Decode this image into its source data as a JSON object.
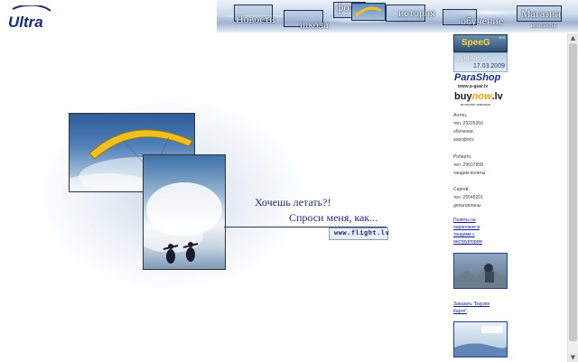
{
  "logo": {
    "text": "Ultra"
  },
  "nav": {
    "news": "Новости",
    "school": "школа",
    "photo": "фото",
    "history": "история",
    "training": "обучение",
    "shop": "Магазин",
    "contacts": "контакты"
  },
  "sidebar": {
    "speedo_label": "SpeeG",
    "speedo_numbers": "104",
    "updated_label": "Updated",
    "updated_date": "17.03.2009",
    "parashop": "ParaShop",
    "parashop_url": "www.a-gear.lv",
    "buynow_1": "buy",
    "buynow_2": "now",
    "buynow_3": ".lv",
    "buynow_sub": "интернет-магазин",
    "contacts": [
      {
        "name": "Антон,",
        "phone": "тел. 29225359",
        "note": "обучение,",
        "note2": "аэрофото"
      },
      {
        "name": "Роберто,",
        "phone": "тел. 29637858",
        "note": "тандем-полеты",
        "note2": ""
      },
      {
        "name": "Сергей,",
        "phone": "тел. 25545201",
        "note": "дельтапланы",
        "note2": ""
      }
    ],
    "link1_lines": [
      "Полеты на",
      "параплане в",
      "тандеме с",
      "инструктором"
    ],
    "link2_lines": [
      "Заказать \"Баузпи",
      "Карте\""
    ]
  },
  "main": {
    "tagline_1": "Хочешь летать?!",
    "tagline_2": "Спроси меня, как...",
    "url_button": "www.flight.lv"
  },
  "colors": {
    "link": "#0b1b8f",
    "tagline": "#1d2a78",
    "wing": "#f0c020"
  }
}
